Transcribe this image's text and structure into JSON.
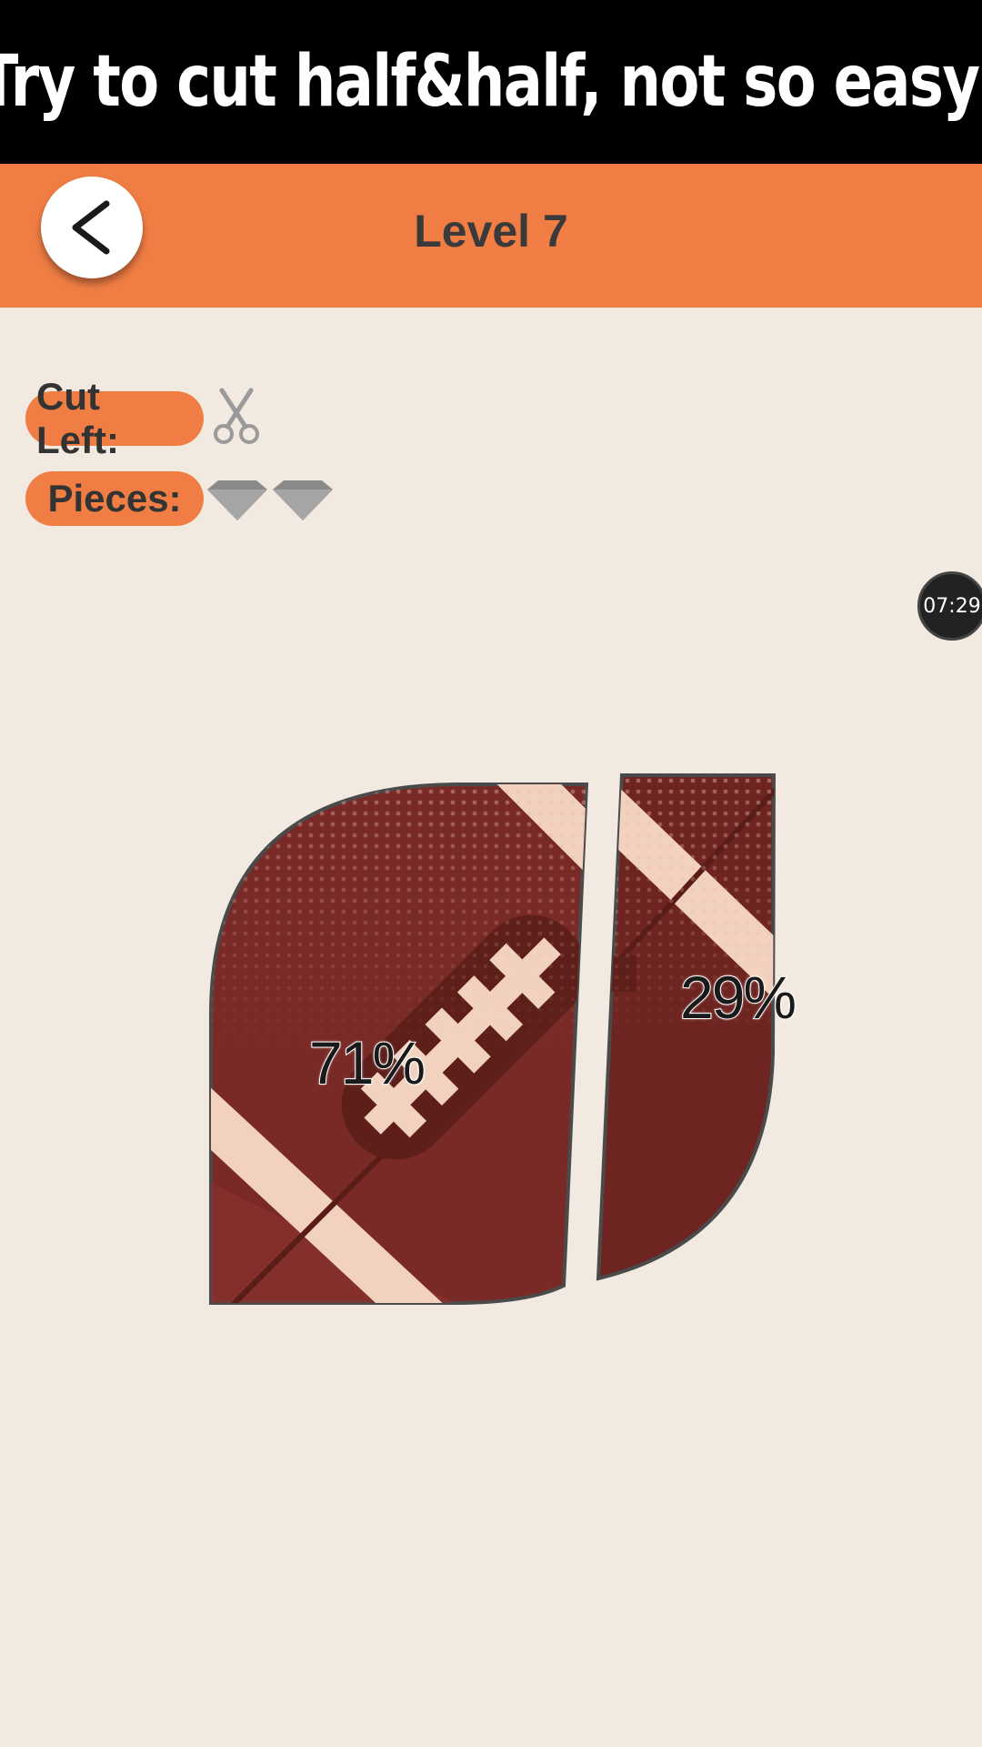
{
  "banner": {
    "text": "Try to cut half&half, not so easy!"
  },
  "header": {
    "back_icon": "chevron-left-icon",
    "level_title": "Level 7"
  },
  "status": {
    "cut_left_label": "Cut Left:",
    "cut_left_icon": "scissors-icon",
    "pieces_label": "Pieces:",
    "piece_icon": "diamond-icon"
  },
  "timer": {
    "value": "07:29"
  },
  "board": {
    "left_piece_percent": "71%",
    "right_piece_percent": "29%"
  },
  "colors": {
    "header": "#ef7d44",
    "background": "#f2e9e0",
    "football": "#7a2a26",
    "lace": "#f2d2bf"
  }
}
